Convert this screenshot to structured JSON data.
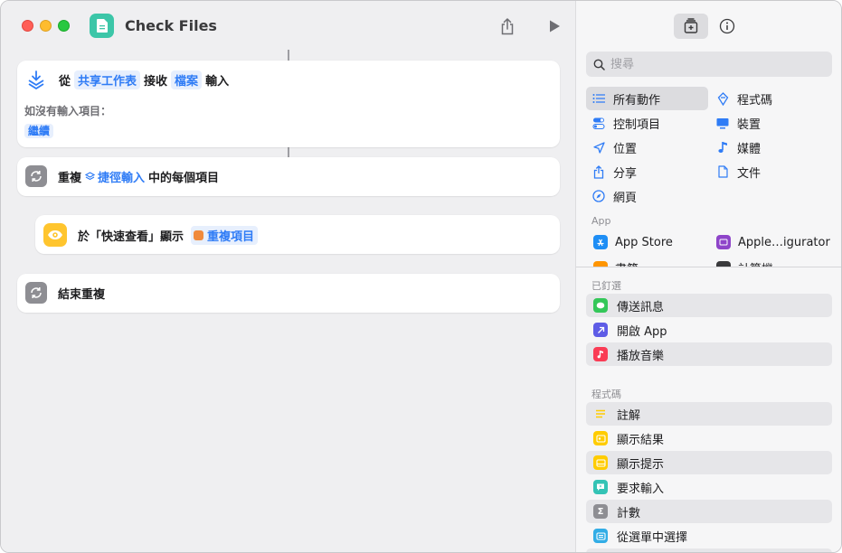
{
  "window": {
    "title": "Check Files"
  },
  "workflow": {
    "receive": {
      "prefix": "從",
      "source_token": "共享工作表",
      "middle": "接收",
      "type_token": "檔案",
      "suffix": "輸入",
      "no_input_label": "如沒有輸入項目：",
      "no_input_value": "繼續"
    },
    "repeat": {
      "label": "重複",
      "token": "捷徑輸入",
      "suffix": "中的每個項目"
    },
    "quicklook": {
      "label": "於「快速查看」顯示",
      "token": "重複項目"
    },
    "end_repeat": {
      "label": "結束重複"
    }
  },
  "sidebar": {
    "search_placeholder": "搜尋",
    "categories_left": [
      {
        "label": "所有動作",
        "icon": "list-icon",
        "selected": true
      },
      {
        "label": "控制項目",
        "icon": "toggle-icon"
      },
      {
        "label": "位置",
        "icon": "location-arrow-icon"
      },
      {
        "label": "分享",
        "icon": "share-icon"
      },
      {
        "label": "網頁",
        "icon": "compass-icon"
      }
    ],
    "categories_right": [
      {
        "label": "程式碼",
        "icon": "code-icon"
      },
      {
        "label": "裝置",
        "icon": "monitor-icon"
      },
      {
        "label": "媒體",
        "icon": "music-note-icon"
      },
      {
        "label": "文件",
        "icon": "document-icon"
      }
    ],
    "app_header": "App",
    "apps": [
      {
        "label": "App Store",
        "color": "#1e8ef5"
      },
      {
        "label": "Apple…igurator",
        "color": "#8e44c9"
      },
      {
        "label": "書籍",
        "color": "#ff9500"
      },
      {
        "label": "計算機",
        "color": "#3a3a3c"
      }
    ],
    "pinned_header": "已釘選",
    "pinned": [
      {
        "label": "傳送訊息",
        "color": "#34c759",
        "icon": "message-bubble-icon"
      },
      {
        "label": "開啟 App",
        "color": "#5e5ce6",
        "icon": "arrow-up-right-icon"
      },
      {
        "label": "播放音樂",
        "color": "#fa3c55",
        "icon": "music-note-icon"
      }
    ],
    "code_header": "程式碼",
    "code_actions": [
      {
        "label": "註解",
        "color": "#ffd60a",
        "icon": "lines-icon"
      },
      {
        "label": "顯示結果",
        "color": "#ffcc00",
        "icon": "result-icon"
      },
      {
        "label": "顯示提示",
        "color": "#ffcc00",
        "icon": "alert-icon"
      },
      {
        "label": "要求輸入",
        "color": "#34c3b5",
        "icon": "input-bubble-icon"
      },
      {
        "label": "計數",
        "color": "#8e8e93",
        "icon": "sigma-icon"
      },
      {
        "label": "從選單中選擇",
        "color": "#32ade6",
        "icon": "menu-icon"
      }
    ]
  },
  "colors": {
    "accent": "#2f7cf6",
    "token_bg": "#e7effd"
  }
}
